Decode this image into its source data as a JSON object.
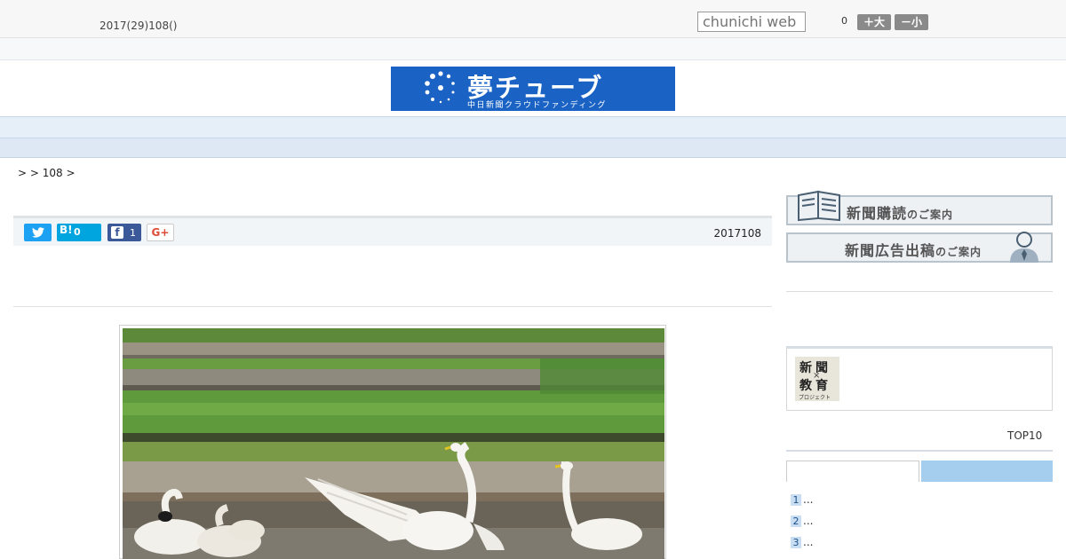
{
  "header": {
    "date": "2017(29)108()",
    "search_placeholder": "chunichi web",
    "count": "0",
    "font_large": "＋大",
    "font_small": "－小"
  },
  "banner": {
    "title": "夢チューブ",
    "subtitle": "中日新聞クラウドファンディング"
  },
  "nav": {
    "items": [
      "",
      "",
      "",
      "",
      "",
      "",
      "",
      "",
      ""
    ]
  },
  "breadcrumb": {
    "text": ">  > 108 >"
  },
  "share": {
    "hatena_label": "B!",
    "hatena_count": "0",
    "facebook_count": "1",
    "gplus_label": "G+"
  },
  "article": {
    "date": "2017108"
  },
  "sidebar": {
    "subscribe_main": "新聞購読",
    "subscribe_suffix": "のご案内",
    "ad_main": "新聞広告出稿",
    "ad_suffix": "のご案内",
    "edu_line1": "新聞",
    "edu_cross": "×",
    "edu_line2": "教育",
    "edu_line3": "プロジェクト",
    "top10_label": "TOP10",
    "ranking": [
      {
        "num": "1",
        "text": "..."
      },
      {
        "num": "2",
        "text": "..."
      },
      {
        "num": "3",
        "text": "..."
      }
    ]
  },
  "colors": {
    "banner_blue": "#1a63c4",
    "nav_bg": "#e6eef8",
    "twitter": "#1da1f2",
    "hatena": "#00a4de",
    "facebook": "#3b5998",
    "tab_active": "#a5cdee"
  }
}
